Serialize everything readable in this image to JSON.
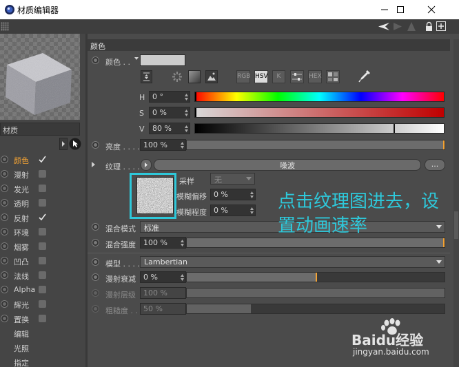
{
  "window": {
    "title": "材质编辑器",
    "controls": [
      "minimize",
      "maximize",
      "close"
    ]
  },
  "left_panel": {
    "material_name": "材质",
    "channels": [
      {
        "label": "颜色",
        "checked": true,
        "active": true
      },
      {
        "label": "漫射",
        "checked": false
      },
      {
        "label": "发光",
        "checked": false
      },
      {
        "label": "透明",
        "checked": false
      },
      {
        "label": "反射",
        "checked": true
      },
      {
        "label": "环境",
        "checked": false
      },
      {
        "label": "烟雾",
        "checked": false
      },
      {
        "label": "凹凸",
        "checked": false
      },
      {
        "label": "法线",
        "checked": false
      },
      {
        "label": "Alpha",
        "checked": false
      },
      {
        "label": "辉光",
        "checked": false
      },
      {
        "label": "置换",
        "checked": false
      },
      {
        "label": "编辑",
        "checked": null
      },
      {
        "label": "光照",
        "checked": null
      },
      {
        "label": "指定",
        "checked": null
      }
    ]
  },
  "color_section": {
    "header": "颜色",
    "color_label": "颜色 . .",
    "mode_buttons": [
      "RGB",
      "HSV",
      "K",
      "HEX"
    ],
    "active_mode": "HSV",
    "h_label": "H",
    "h_value": "0 °",
    "s_label": "S",
    "s_value": "0 %",
    "v_label": "V",
    "v_value": "80 %",
    "brightness_label": "亮度 . . . .",
    "brightness_value": "100 %",
    "texture_label": "纹理 . . . .",
    "texture_name": "噪波",
    "texture_more": "...",
    "sampling_label": "采样",
    "sampling_value": "无",
    "blur_offset_label": "模糊偏移",
    "blur_offset_value": "0 %",
    "blur_scale_label": "模糊程度",
    "blur_scale_value": "0 %",
    "mix_mode_label": "混合模式",
    "mix_mode_value": "标准",
    "mix_strength_label": "混合强度",
    "mix_strength_value": "100 %",
    "model_label": "模型 . . . .",
    "model_value": "Lambertian",
    "diffuse_falloff_label": "漫射衰减",
    "diffuse_falloff_value": "0 %",
    "diffuse_level_label": "漫射层级",
    "diffuse_level_value": "100 %",
    "roughness_label": "粗糙度 . .",
    "roughness_value": "50 %"
  },
  "annotation": {
    "line1": "点击纹理图进去，设",
    "line2": "置动画速率"
  },
  "watermark": {
    "brand": "Baidu经验",
    "url": "jingyan.baidu.com"
  },
  "colors": {
    "accent": "#f2a234",
    "annotation": "#2ec8da",
    "highlight_box": "#2ec8da"
  }
}
